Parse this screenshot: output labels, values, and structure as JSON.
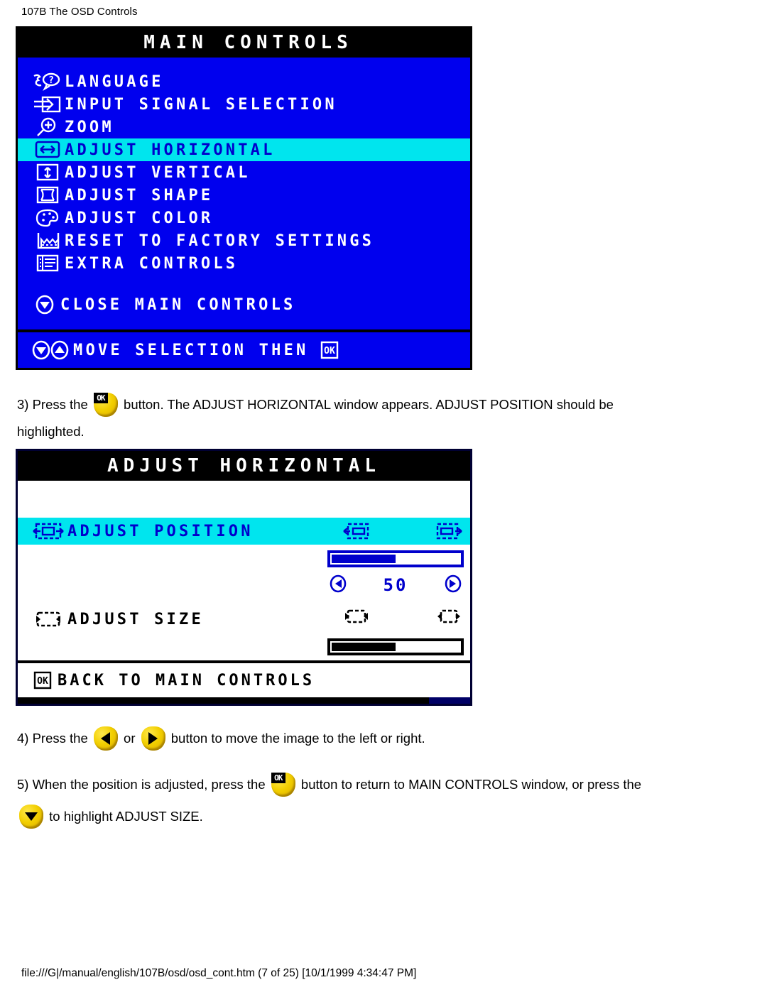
{
  "page": {
    "header": "107B The OSD Controls",
    "footer_path": "file:///G|/manual/english/107B/osd/osd_cont.htm (7 of 25) [10/1/1999 4:34:47 PM]"
  },
  "colors": {
    "osd_blue": "#0000ee",
    "highlight_cyan": "#00e5ee",
    "highlight_text": "#0000cc",
    "button_yellow": "#f2cf00",
    "black": "#000000",
    "white": "#ffffff"
  },
  "main_controls": {
    "title": "MAIN CONTROLS",
    "items": [
      {
        "icon": "language-icon",
        "label": "LANGUAGE",
        "selected": false
      },
      {
        "icon": "input-signal-icon",
        "label": "INPUT SIGNAL SELECTION",
        "selected": false
      },
      {
        "icon": "zoom-icon",
        "label": "ZOOM",
        "selected": false
      },
      {
        "icon": "adjust-horizontal-icon",
        "label": "ADJUST HORIZONTAL",
        "selected": true
      },
      {
        "icon": "adjust-vertical-icon",
        "label": "ADJUST VERTICAL",
        "selected": false
      },
      {
        "icon": "adjust-shape-icon",
        "label": "ADJUST SHAPE",
        "selected": false
      },
      {
        "icon": "adjust-color-icon",
        "label": "ADJUST COLOR",
        "selected": false
      },
      {
        "icon": "factory-reset-icon",
        "label": "RESET TO FACTORY SETTINGS",
        "selected": false
      },
      {
        "icon": "extra-controls-icon",
        "label": "EXTRA CONTROLS",
        "selected": false
      }
    ],
    "close_item": {
      "icon": "down-arrow-button-icon",
      "label": "CLOSE MAIN CONTROLS"
    },
    "footer_item": {
      "icon": "up-down-arrow-buttons-icon",
      "label": "MOVE SELECTION THEN",
      "trailing_icon": "ok-button-icon"
    }
  },
  "adjust_horizontal": {
    "title": "ADJUST HORIZONTAL",
    "rows": [
      {
        "icon": "position-arrows-icon",
        "label": "ADJUST POSITION",
        "selected": true,
        "left_icon": "shift-left-icon",
        "right_icon": "shift-right-icon",
        "value": "50",
        "fill_percent": 50,
        "dec_icon": "left-arrow-icon",
        "inc_icon": "right-arrow-icon"
      },
      {
        "icon": "size-arrows-icon",
        "label": "ADJUST SIZE",
        "selected": false,
        "left_icon": "narrow-icon",
        "right_icon": "widen-icon",
        "value": "50",
        "fill_percent": 50,
        "dec_icon": "left-arrow-icon",
        "inc_icon": "right-arrow-icon"
      }
    ],
    "footer_item": {
      "icon": "ok-button-icon",
      "label": "BACK TO MAIN CONTROLS"
    }
  },
  "instructions": {
    "step3_a": "3) Press the",
    "step3_b": "button. The ADJUST HORIZONTAL window appears. ADJUST POSITION should be",
    "step3_c": "highlighted.",
    "step4_a": "4) Press the",
    "step4_or": "or",
    "step4_b": "button to move the image to the left or right.",
    "step5_a": "5) When the position is adjusted, press the",
    "step5_b": "button to return to MAIN CONTROLS window, or press the",
    "step5_c": "to highlight ADJUST SIZE.",
    "ok_glyph": "OK"
  }
}
